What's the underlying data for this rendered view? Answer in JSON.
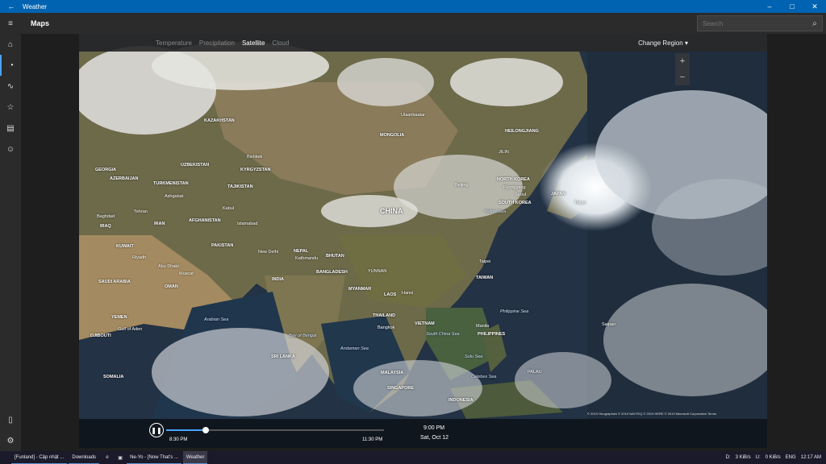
{
  "window": {
    "title": "Weather",
    "back": "←",
    "minimize": "–",
    "maximize": "□",
    "close": "✕"
  },
  "header": {
    "title": "Maps",
    "search_placeholder": "Search",
    "search_icon": "⌕"
  },
  "sidebar": {
    "items": [
      {
        "name": "hamburger-icon",
        "glyph": "≡"
      },
      {
        "name": "home-icon",
        "glyph": "⌂"
      },
      {
        "name": "maps-icon",
        "glyph": "◔"
      },
      {
        "name": "historical-icon",
        "glyph": "∿"
      },
      {
        "name": "favorites-icon",
        "glyph": "☆"
      },
      {
        "name": "news-icon",
        "glyph": "▤"
      },
      {
        "name": "life-icon",
        "glyph": "☺"
      }
    ],
    "bottom": [
      {
        "name": "phone-icon",
        "glyph": "▯"
      },
      {
        "name": "settings-icon",
        "glyph": "⚙"
      }
    ]
  },
  "map": {
    "tabs": [
      "Temperature",
      "Precipitation",
      "Satellite",
      "Cloud"
    ],
    "selected_tab": "Satellite",
    "change_region": "Change Region",
    "zoom_in": "+",
    "zoom_out": "−",
    "labels": {
      "kazakhstan": "KAZAKHSTAN",
      "mongolia": "MONGOLIA",
      "ulaanbaatar": "Ulaanbaatar",
      "uzbekistan": "UZBEKISTAN",
      "turkmenistan": "TURKMENISTAN",
      "kyrgyzstan": "KYRGYZSTAN",
      "tajikistan": "TAJIKISTAN",
      "georgia": "GEORGIA",
      "azerbaijan": "AZERBAIJAN",
      "tehran": "Tehran",
      "iran": "IRAN",
      "iraq": "IRAQ",
      "baghdad": "Baghdad",
      "afghanistan": "AFGHANISTAN",
      "kabul": "Kabul",
      "islamabad": "Islamabad",
      "pakistan": "PAKISTAN",
      "kuwait": "KUWAIT",
      "riyadh": "Riyadh",
      "saudi_arabia": "SAUDI ARABIA",
      "abu_dhabi": "Abu Dhabi",
      "muscat": "Muscat",
      "oman": "OMAN",
      "yemen": "YEMEN",
      "djibouti": "DJIBOUTI",
      "gulf_of_aden": "Gulf of Aden",
      "somalia": "SOMALIA",
      "new_delhi": "New Delhi",
      "nepal": "NEPAL",
      "kathmandu": "Kathmandu",
      "bhutan": "BHUTAN",
      "india": "INDIA",
      "bangladesh": "BANGLADESH",
      "arabian_sea": "Arabian Sea",
      "bay_of_bengal": "Bay of Bengal",
      "sri_lanka": "SRI LANKA",
      "andaman_sea": "Andaman Sea",
      "myanmar": "MYANMAR",
      "laos": "LAOS",
      "thailand": "THAILAND",
      "bangkok": "Bangkok",
      "vietnam": "VIETNAM",
      "malaysia": "MALAYSIA",
      "singapore": "SINGAPORE",
      "indonesia": "INDONESIA",
      "china": "CHINA",
      "beijing": "Beijing",
      "north_korea": "NORTH KOREA",
      "pyongyang": "Pyongyang",
      "seoul": "Seoul",
      "south_korea": "SOUTH KOREA",
      "yellow_sea": "Yellow Sea",
      "japan": "JAPAN",
      "tokyo": "Tokyo",
      "taiwan": "TAIWAN",
      "taipei": "Taipei",
      "hanoi": "Hanoi",
      "manila": "Manila",
      "philippines": "PHILIPPINES",
      "philippine_sea": "Philippine Sea",
      "south_china_sea": "South China Sea",
      "sulu_sea": "Sulu Sea",
      "celebes_sea": "Celebes Sea",
      "heilongjiang": "HEILONGJIANG",
      "jilin": "JILIN",
      "bishkek": "Bishkek",
      "ashgabat": "Ashgabat",
      "yunnan": "YUNNAN",
      "palau": "PALAU",
      "saipan": "Saipan"
    },
    "attribution": "© 2019 Geographies  © 2019 NAVTEQ  © 2019 HERE  © 2019 Microsoft Corporation  Terms",
    "timeline": {
      "play_glyph": "❚❚",
      "start_label": "8:30 PM",
      "end_label": "11:30 PM",
      "current_time": "9:00 PM",
      "current_date": "Sat, Oct 12",
      "progress": 0.18
    }
  },
  "taskbar": {
    "apps": [
      {
        "label": "[Funland] - Cập nhật ...",
        "active": false
      },
      {
        "label": "Downloads",
        "active": false
      },
      {
        "label": "Ne-Yo - [Now That's ...",
        "active": false
      },
      {
        "label": "Weather",
        "active": true
      }
    ],
    "tray": {
      "lang": "ENG",
      "time": "12:17 AM",
      "net_down": "3 KiB/s",
      "net_up": "0 KiB/s",
      "drive_d": "D:",
      "drive_u": "U:"
    }
  }
}
